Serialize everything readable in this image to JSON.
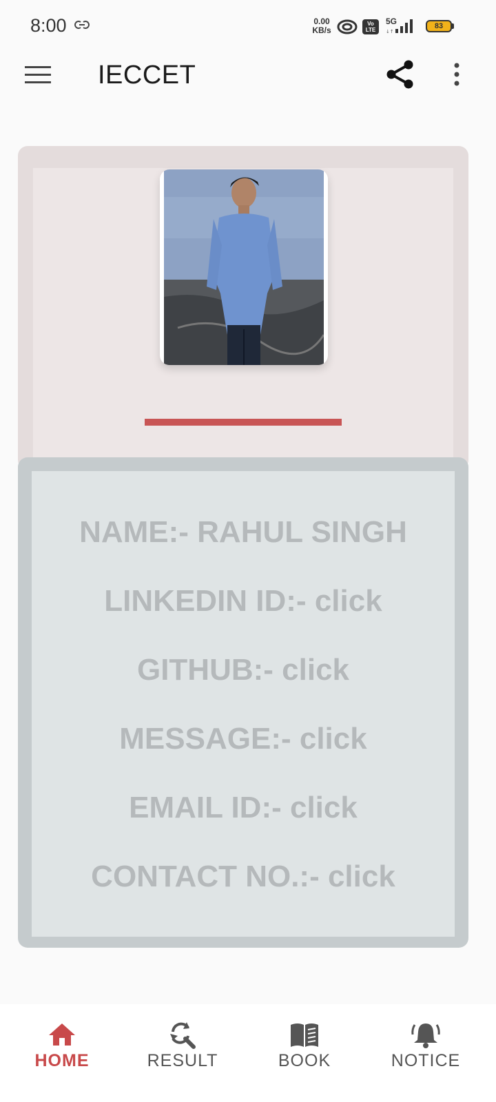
{
  "status_bar": {
    "time": "8:00",
    "net_speed_value": "0.00",
    "net_speed_unit": "KB/s",
    "volte_top": "Vo",
    "volte_bottom": "LTE",
    "network_type": "5G",
    "battery": "83",
    "battery_color": "#f2b21a"
  },
  "app_bar": {
    "title": "IECCET"
  },
  "profile": {
    "accent_color": "#c85555"
  },
  "details": [
    "NAME:- RAHUL SINGH",
    "LINKEDIN ID:- click",
    "GITHUB:- click",
    "MESSAGE:- click",
    "EMAIL ID:- click",
    "CONTACT NO.:- click"
  ],
  "bottom_nav": {
    "active_color": "#c8494a",
    "items": [
      {
        "label": "HOME",
        "icon": "home-icon"
      },
      {
        "label": "RESULT",
        "icon": "result-search-icon"
      },
      {
        "label": "BOOK",
        "icon": "book-icon"
      },
      {
        "label": "NOTICE",
        "icon": "bell-icon"
      }
    ]
  }
}
